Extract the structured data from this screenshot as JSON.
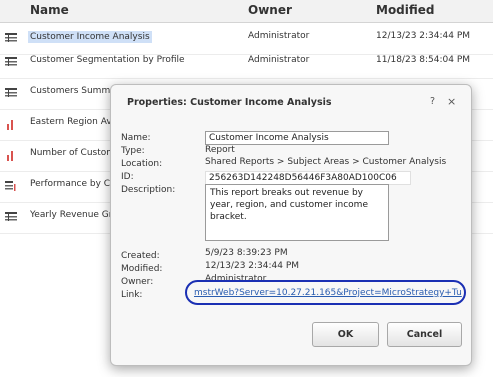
{
  "header": {
    "name": "Name",
    "owner": "Owner",
    "modified": "Modified"
  },
  "rows": [
    {
      "name": "Customer Income Analysis",
      "owner": "Administrator",
      "modified": "12/13/23 2:34:44 PM",
      "icon": "grid-report-icon"
    },
    {
      "name": "Customer Segmentation by Profile",
      "owner": "Administrator",
      "modified": "11/18/23 8:54:04 PM",
      "icon": "grid-report-icon"
    },
    {
      "name": "Customers Summary",
      "owner": "",
      "modified": "",
      "icon": "grid-report-icon"
    },
    {
      "name": "Eastern Region Aver",
      "owner": "",
      "modified": "",
      "icon": "bar-chart-icon"
    },
    {
      "name": "Number of Custome",
      "owner": "",
      "modified": "",
      "icon": "bar-chart-icon"
    },
    {
      "name": "Performance by Cus",
      "owner": "",
      "modified": "",
      "icon": "grid-graph-icon"
    },
    {
      "name": "Yearly Revenue Gro",
      "owner": "",
      "modified": "",
      "icon": "grid-report-icon"
    }
  ],
  "dialog": {
    "title": "Properties: Customer Income Analysis",
    "help": "?",
    "close": "×",
    "labels": {
      "name": "Name:",
      "type": "Type:",
      "location": "Location:",
      "id": "ID:",
      "description": "Description:",
      "created": "Created:",
      "modified": "Modified:",
      "owner": "Owner:",
      "link": "Link:"
    },
    "values": {
      "name": "Customer Income Analysis",
      "type": "Report",
      "location": "Shared Reports > Subject Areas > Customer Analysis",
      "id": "256263D142248D56446F3A80AD100C06",
      "description": "This report breaks out revenue by year, region, and customer income bracket.",
      "created": "5/9/23 8:39:23 PM",
      "modified": "12/13/23 2:34:44 PM",
      "owner": "Administrator",
      "link": "mstrWeb?Server=10.27.21.165&Project=MicroStrategy+Tu"
    },
    "buttons": {
      "ok": "OK",
      "cancel": "Cancel"
    }
  },
  "colors": {
    "selection": "#cfe0f7",
    "link": "#2a5db0",
    "highlight_oval": "#1a2fb3",
    "bar_icon": "#d9534f"
  }
}
